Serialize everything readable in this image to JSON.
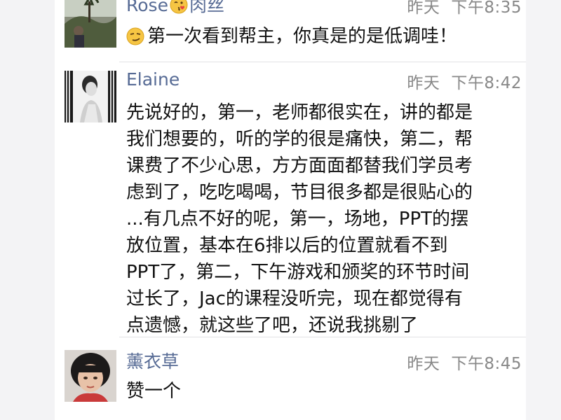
{
  "comments": [
    {
      "name": "Rose",
      "name_suffix": "肉丝",
      "name_emoji": "kissing-heart-emoji",
      "time_day": "昨天",
      "time_clock": "下午8:35",
      "text_emoji": "smirk-emoji",
      "text": "第一次看到帮主，你真是的是低调哇！"
    },
    {
      "name": "Elaine",
      "time_day": "昨天",
      "time_clock": "下午8:42",
      "lines": [
        "先说好的，第一，老师都很实在，讲的都是",
        "我们想要的，听的学的很是痛快，第二，帮",
        "课费了不少心思，方方面面都替我们学员考",
        "虑到了，吃吃喝喝，节目很多都是很贴心的",
        "...有几点不好的呢，第一，场地，PPT的摆",
        "放位置，基本在6排以后的位置就看不到",
        "PPT了，第二，下午游戏和颁奖的环节时间",
        "过长了，Jac的课程没听完，现在都觉得有",
        "点遗憾，就这些了吧，还说我挑剔了"
      ]
    },
    {
      "name": "薰衣草",
      "time_day": "昨天",
      "time_clock": "下午8:45",
      "text": "赞一个"
    }
  ],
  "colors": {
    "name": "#576b95",
    "time": "#888888",
    "text": "#111111",
    "divider": "#e1e1e4"
  }
}
